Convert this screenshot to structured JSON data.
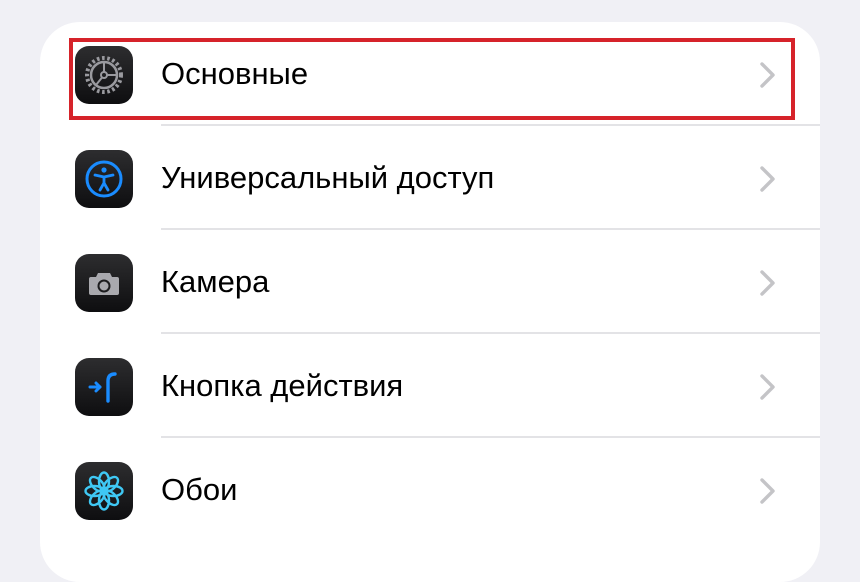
{
  "settings": {
    "items": [
      {
        "label": "Основные",
        "icon": "gear-icon"
      },
      {
        "label": "Универсальный доступ",
        "icon": "accessibility-icon"
      },
      {
        "label": "Камера",
        "icon": "camera-icon"
      },
      {
        "label": "Кнопка действия",
        "icon": "action-button-icon"
      },
      {
        "label": "Обои",
        "icon": "flower-wallpaper-icon"
      }
    ],
    "highlighted_item": "Основные"
  },
  "colors": {
    "background": "#f0f0f5",
    "card": "#ffffff",
    "highlight_border": "#d6232a",
    "accent_blue": "#1a8cff",
    "wallpaper_cyan": "#3fc8f4",
    "chevron": "#c4c4c7",
    "divider": "#e3e3e6"
  }
}
